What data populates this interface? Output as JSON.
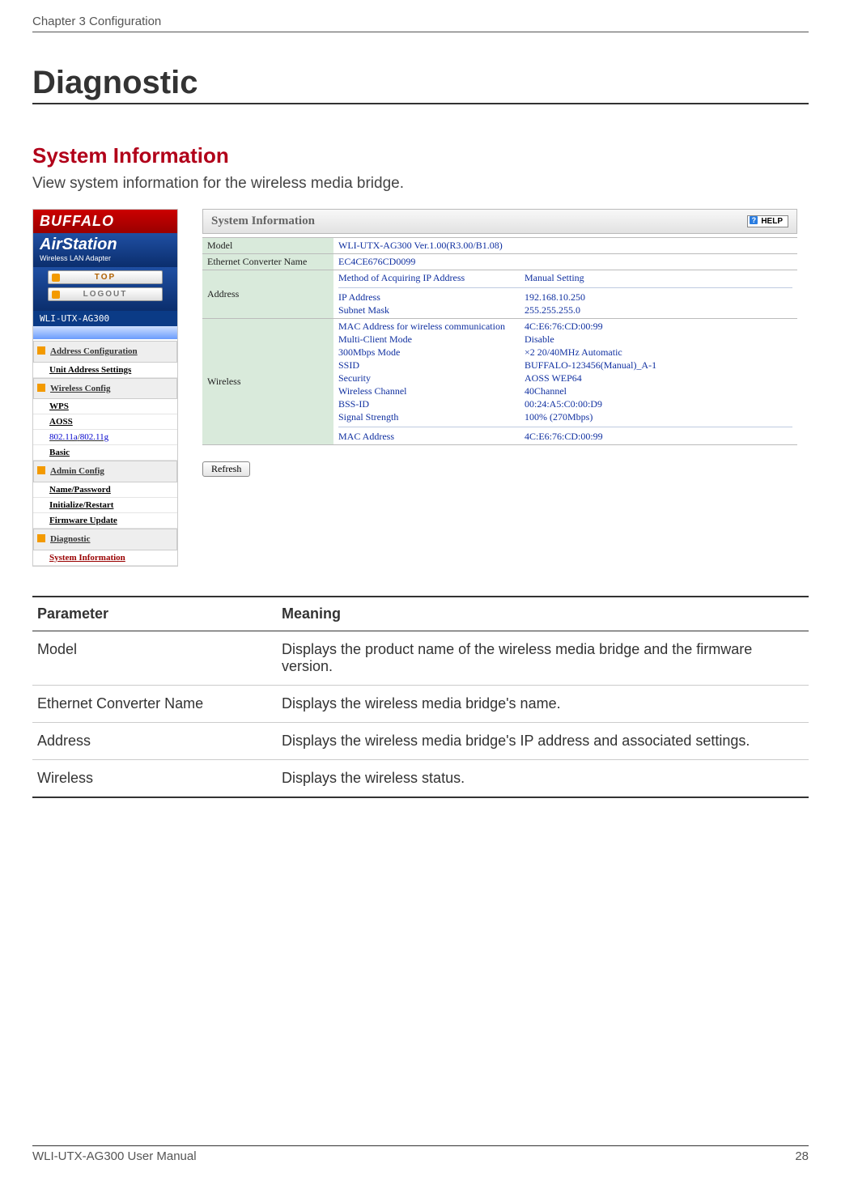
{
  "header": {
    "chapter": "Chapter 3  Configuration"
  },
  "h1": "Diagnostic",
  "h2": "System Information",
  "desc": "View system information for the wireless media bridge.",
  "sidebar": {
    "brand": "BUFFALO",
    "product_line1": "AirStation",
    "product_line2": "Wireless LAN Adapter",
    "top_btn": "TOP",
    "logout_btn": "LOGOUT",
    "device": "WLI-UTX-AG300",
    "address_cfg": "Address Configuration",
    "unit_addr": "Unit Address Settings",
    "wireless_cfg": "Wireless Config",
    "wps": "WPS",
    "aoss": "AOSS",
    "band_a": "802.11a",
    "band_sep": "/",
    "band_g": "802.11g",
    "basic": "Basic",
    "admin_cfg": "Admin Config",
    "name_pw": "Name/Password",
    "init": "Initialize/Restart",
    "fw": "Firmware Update",
    "diag": "Diagnostic",
    "sysinfo": "System Information"
  },
  "panel": {
    "title": "System Information",
    "help": "HELP",
    "refresh": "Refresh",
    "rows": {
      "model_label": "Model",
      "model_value": "WLI-UTX-AG300 Ver.1.00(R3.00/B1.08)",
      "ecn_label": "Ethernet Converter Name",
      "ecn_value": "EC4CE676CD0099",
      "addr_label": "Address",
      "addr_k1": "Method of Acquiring IP Address",
      "addr_v1": "Manual Setting",
      "addr_k2": "IP Address",
      "addr_v2": "192.168.10.250",
      "addr_k3": "Subnet Mask",
      "addr_v3": "255.255.255.0",
      "w_label": "Wireless",
      "w_k1": "MAC Address for wireless communication",
      "w_v1": "4C:E6:76:CD:00:99",
      "w_k2": "Multi-Client Mode",
      "w_v2": "Disable",
      "w_k3": "300Mbps Mode",
      "w_v3": "×2 20/40MHz Automatic",
      "w_k4": "SSID",
      "w_v4": "BUFFALO-123456(Manual)_A-1",
      "w_k5": "Security",
      "w_v5": "AOSS WEP64",
      "w_k6": "Wireless Channel",
      "w_v6": "40Channel",
      "w_k7": "BSS-ID",
      "w_v7": "00:24:A5:C0:00:D9",
      "w_k8": "Signal Strength",
      "w_v8": "100% (270Mbps)",
      "w_k9": "MAC Address",
      "w_v9": "4C:E6:76:CD:00:99"
    }
  },
  "param_table": {
    "head_param": "Parameter",
    "head_meaning": "Meaning",
    "rows": [
      {
        "p": "Model",
        "m": "Displays the product name of the wireless media bridge and the firmware version."
      },
      {
        "p": "Ethernet Converter Name",
        "m": "Displays the wireless media bridge's name."
      },
      {
        "p": "Address",
        "m": "Displays the wireless media bridge's IP address and associated settings."
      },
      {
        "p": "Wireless",
        "m": "Displays the wireless status."
      }
    ]
  },
  "footer": {
    "left": "WLI-UTX-AG300 User Manual",
    "right": "28"
  }
}
